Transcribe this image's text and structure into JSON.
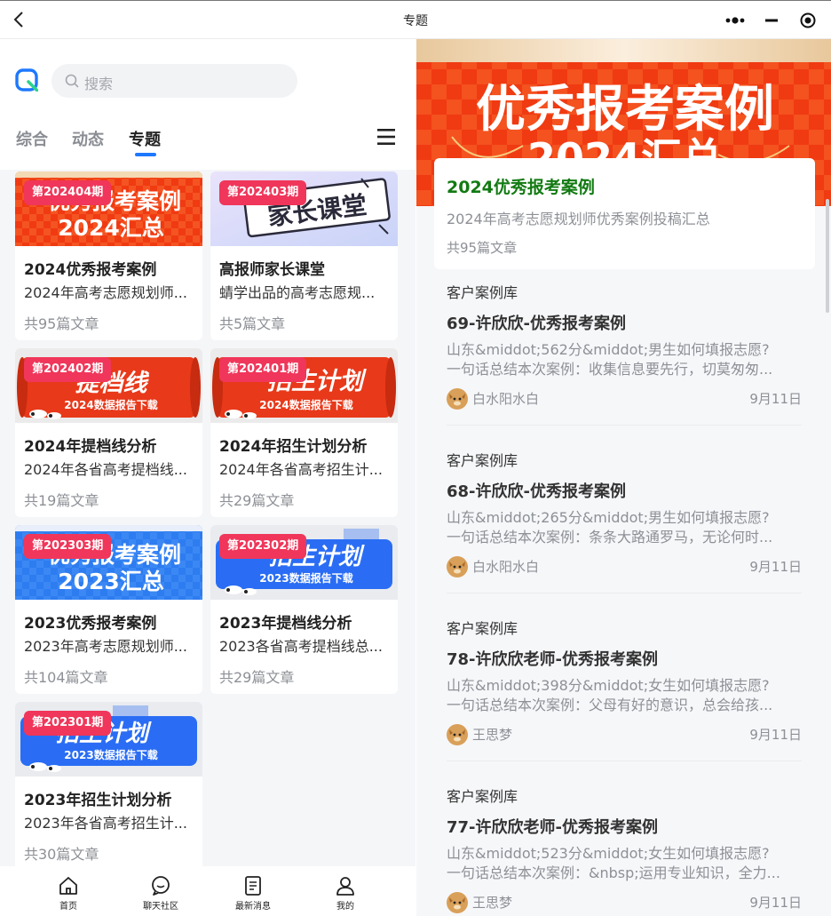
{
  "header": {
    "title": "专题"
  },
  "search": {
    "placeholder": "搜索"
  },
  "tabs": [
    {
      "label": "综合",
      "active": false
    },
    {
      "label": "动态",
      "active": false
    },
    {
      "label": "专题",
      "active": true
    }
  ],
  "cards": [
    {
      "period": "第202404期",
      "title": "2024优秀报考案例",
      "desc": "2024年高考志愿规划师...",
      "count": "共95篇文章",
      "thumb": {
        "line1": "优秀报考案例",
        "line2": "2024汇总",
        "theme": "red"
      }
    },
    {
      "period": "第202403期",
      "title": "高报师家长课堂",
      "desc": "蜻学出品的高考志愿规...",
      "count": "共5篇文章",
      "thumb": {
        "line1": "家长课堂",
        "line2": "",
        "theme": "lilac"
      }
    },
    {
      "period": "第202402期",
      "title": "2024年提档线分析",
      "desc": "2024年各省高考提档线...",
      "count": "共19篇文章",
      "thumb": {
        "line1": "提档线",
        "line2": "2024数据报告下载",
        "theme": "scroll"
      }
    },
    {
      "period": "第202401期",
      "title": "2024年招生计划分析",
      "desc": "2024年各省高考招生计...",
      "count": "共29篇文章",
      "thumb": {
        "line1": "招生计划",
        "line2": "2024数据报告下载",
        "theme": "scroll"
      }
    },
    {
      "period": "第202303期",
      "title": "2023优秀报考案例",
      "desc": "2023年高考志愿规划师...",
      "count": "共104篇文章",
      "thumb": {
        "line1": "优秀报考案例",
        "line2": "2023汇总",
        "theme": "blue"
      }
    },
    {
      "period": "第202302期",
      "title": "2023年提档线分析",
      "desc": "2023各省高考提档线总...",
      "count": "共29篇文章",
      "thumb": {
        "line1": "招生计划",
        "line2": "2023数据报告下载",
        "theme": "bluescroll"
      }
    },
    {
      "period": "第202301期",
      "title": "2023年招生计划分析",
      "desc": "2023年各省高考招生计...",
      "count": "共30篇文章",
      "thumb": {
        "line1": "招生计划",
        "line2": "2023数据报告下载",
        "theme": "bluescroll"
      }
    }
  ],
  "tabbar": [
    {
      "label": "首页",
      "icon": "home-icon"
    },
    {
      "label": "聊天社区",
      "icon": "chat-icon"
    },
    {
      "label": "最新消息",
      "icon": "news-icon"
    },
    {
      "label": "我的",
      "icon": "profile-icon"
    }
  ],
  "topic": {
    "banner_line1": "优秀报考案例",
    "banner_line2": "2024汇总",
    "title": "2024优秀报考案例",
    "desc": "2024年高考志愿规划师优秀案例投稿汇总",
    "count": "共95篇文章"
  },
  "articles": [
    {
      "tag": "客户案例库",
      "title": "69-许欣欣-优秀报考案例",
      "line1": "山东&middot;562分&middot;男生如何填报志愿?",
      "line2": "一句话总结本次案例：收集信息要先行，切莫匆匆...",
      "author": "白水阳水白",
      "date": "9月11日"
    },
    {
      "tag": "客户案例库",
      "title": "68-许欣欣-优秀报考案例",
      "line1": "山东&middot;265分&middot;男生如何填报志愿?",
      "line2": "一句话总结本次案例：条条大路通罗马，无论何时...",
      "author": "白水阳水白",
      "date": "9月11日"
    },
    {
      "tag": "客户案例库",
      "title": "78-许欣欣老师-优秀报考案例",
      "line1": "山东&middot;398分&middot;女生如何填报志愿?",
      "line2": "一句话总结本次案例：父母有好的意识，总会给孩...",
      "author": "王思梦",
      "date": "9月11日"
    },
    {
      "tag": "客户案例库",
      "title": "77-许欣欣老师-优秀报考案例",
      "line1": "山东&middot;523分&middot;女生如何填报志愿?",
      "line2": "一句话总结本次案例：&nbsp;运用专业知识，全力...",
      "author": "王思梦",
      "date": "9月11日"
    }
  ],
  "colors": {
    "accent": "#1e78ff",
    "badge": "#f0365a",
    "topic_title": "#127a12",
    "tag_highlight": "#c8e1fb"
  }
}
